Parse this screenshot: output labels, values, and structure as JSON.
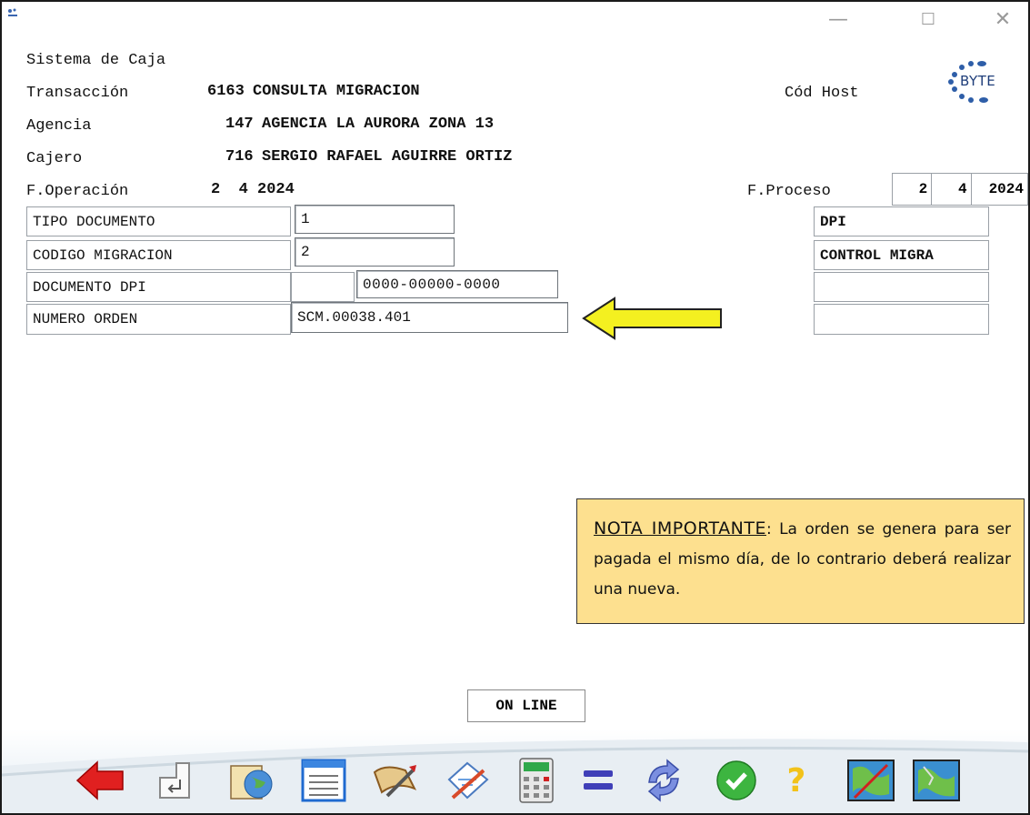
{
  "window": {
    "minimize_icon": "minimize-icon",
    "maximize_icon": "maximize-icon",
    "close_icon": "close-icon",
    "minimize_glyph": "—",
    "maximize_glyph": "☐",
    "close_glyph": "✕"
  },
  "header": {
    "system_title": "Sistema de Caja",
    "transaction_label": "Transacción",
    "transaction_code": "6163",
    "transaction_name": "CONSULTA MIGRACION",
    "host_label": "Cód Host",
    "logo_text": "BYTE",
    "agency_label": "Agencia",
    "agency_code": "147",
    "agency_name": "AGENCIA LA AURORA ZONA 13",
    "cashier_label": "Cajero",
    "cashier_code": "716",
    "cashier_name": "SERGIO RAFAEL AGUIRRE ORTIZ",
    "operation_label": "F.Operación",
    "operation_date": "2  4 2024",
    "process_label": "F.Proceso",
    "process_day": "2",
    "process_month": "4",
    "process_year": "2024"
  },
  "form": {
    "rows": [
      {
        "label": "TIPO DOCUMENTO",
        "value": "1",
        "description": "DPI"
      },
      {
        "label": "CODIGO MIGRACION",
        "value": "2",
        "description": "CONTROL MIGRA"
      },
      {
        "label": "DOCUMENTO DPI",
        "value": "0000-00000-0000",
        "description": ""
      },
      {
        "label": "NUMERO ORDEN",
        "value": "SCM.00038.401",
        "description": ""
      }
    ]
  },
  "note": {
    "title": "NOTA IMPORTANTE",
    "text": ": La orden se genera para ser pagada el mismo día, de lo contrario deberá realizar una nueva."
  },
  "status": {
    "text": "ON LINE"
  },
  "colors": {
    "arrow": "#f4f020",
    "note_bg": "#fde08f"
  },
  "toolbar": {
    "icons": [
      "back-arrow-icon",
      "enter-key-icon",
      "world-book-icon",
      "document-list-icon",
      "scroll-pen-icon",
      "edit-pencil-icon",
      "calculator-icon",
      "equals-icon",
      "refresh-icon",
      "check-icon",
      "help-icon",
      "map-icon",
      "map-alt-icon"
    ],
    "help_glyph": "?"
  }
}
